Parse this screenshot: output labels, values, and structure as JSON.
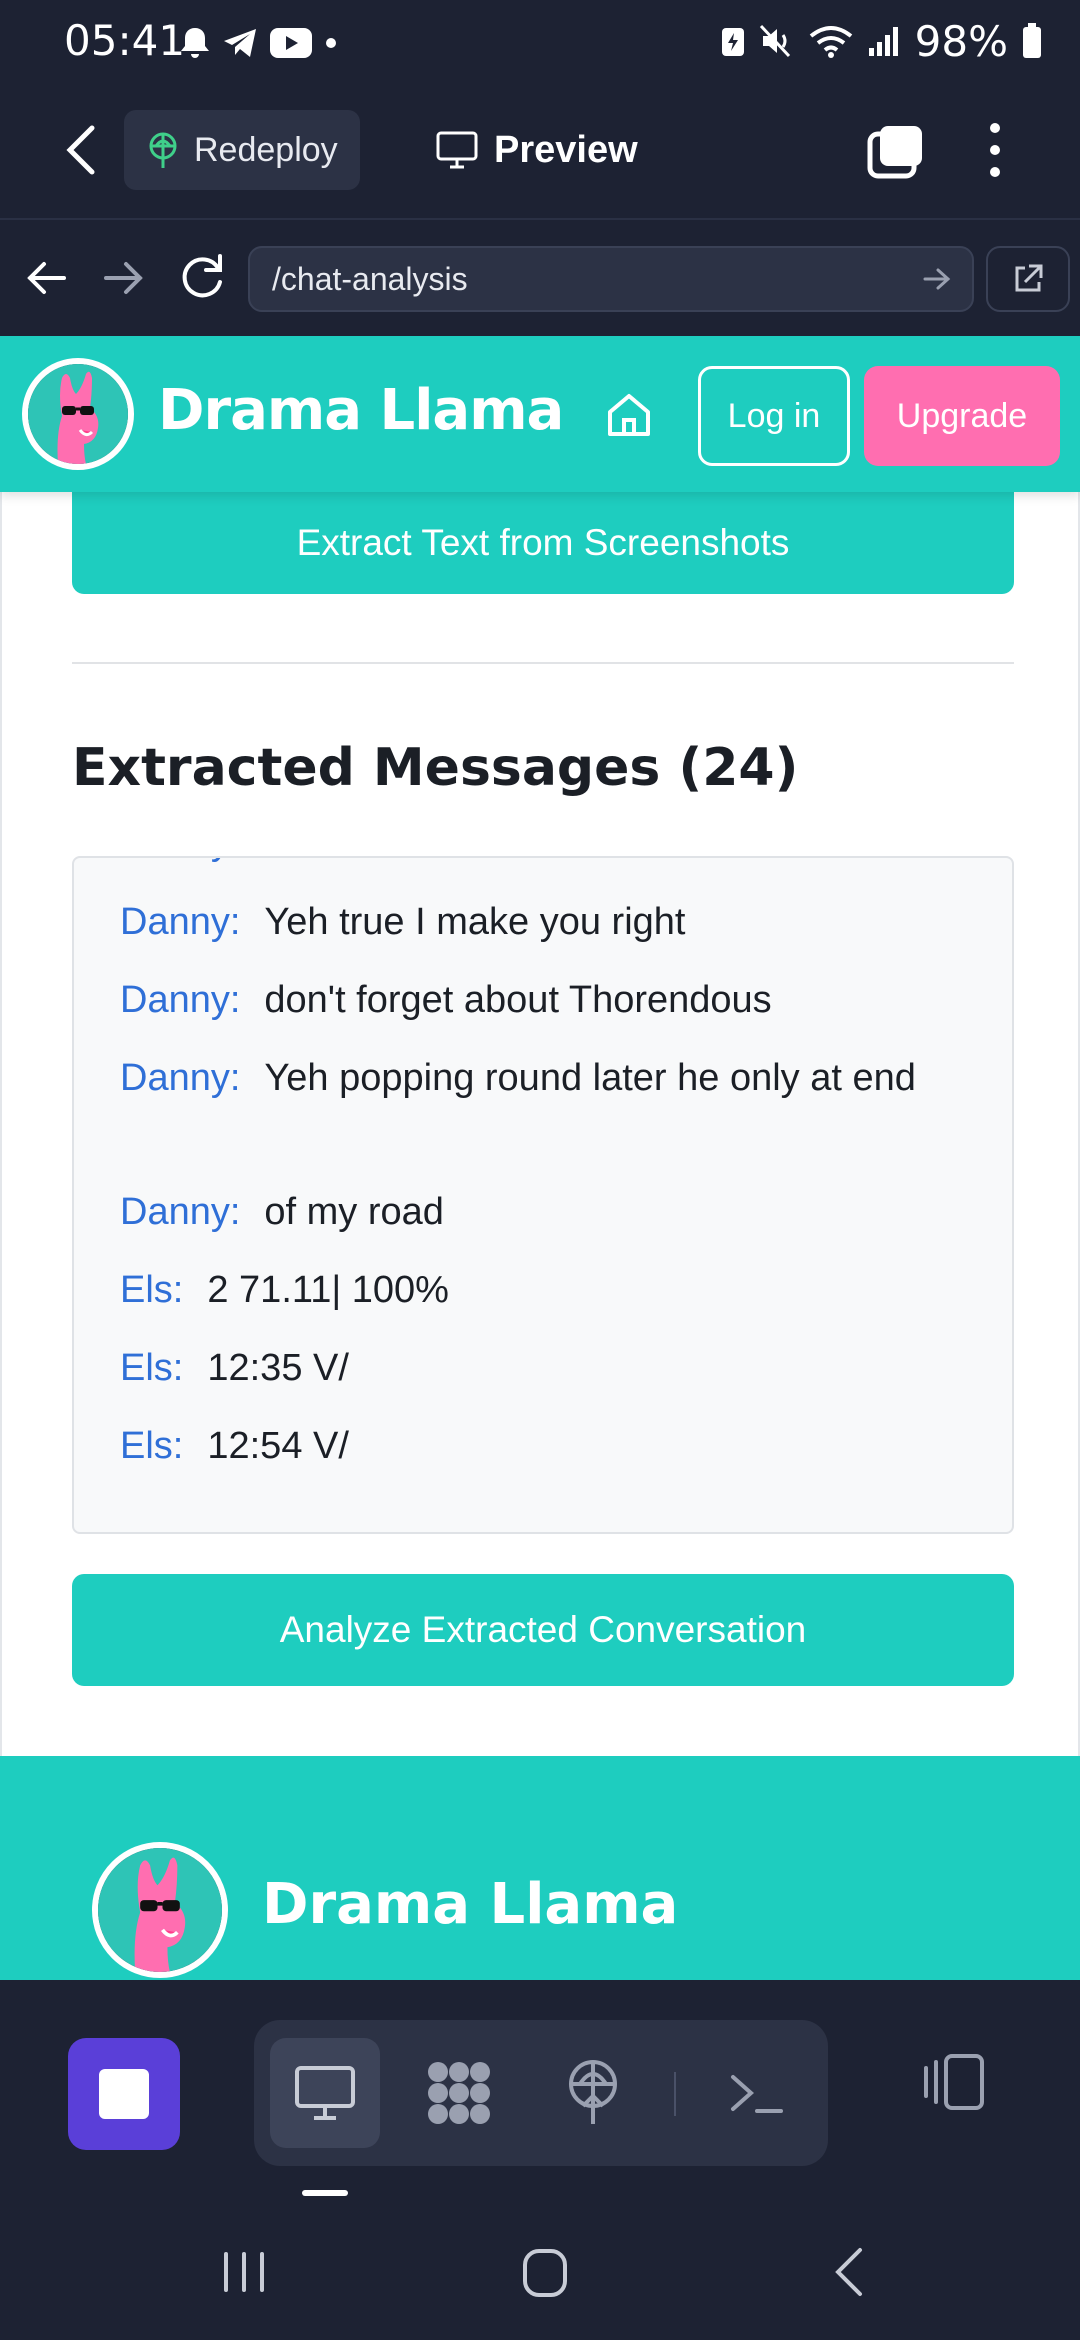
{
  "status_bar": {
    "time": "05:41",
    "battery": "98%"
  },
  "app_toolbar": {
    "redeploy_label": "Redeploy",
    "preview_label": "Preview"
  },
  "browser": {
    "url": "/chat-analysis"
  },
  "site": {
    "brand": "Drama Llama",
    "login_label": "Log in",
    "upgrade_label": "Upgrade",
    "extract_button": "Extract Text from Screenshots",
    "section_title": "Extracted Messages (24)",
    "messages": [
      {
        "sender": "Danny:",
        "text": "Yeh true I make you right"
      },
      {
        "sender": "Danny:",
        "text": "don't forget about Thorendous"
      },
      {
        "sender": "Danny:",
        "text": "Yeh popping round later he only at end"
      },
      {
        "sender": "Danny:",
        "text": "of my road"
      },
      {
        "sender": "Els:",
        "text": "2 71.11| 100%"
      },
      {
        "sender": "Els:",
        "text": "12:35 V/"
      },
      {
        "sender": "Els:",
        "text": "12:54 V/"
      }
    ],
    "analyze_button": "Analyze Extracted Conversation",
    "footer_brand": "Drama Llama"
  },
  "colors": {
    "teal": "#1ecdbf",
    "pink": "#ff6eb0",
    "dark": "#1d2233",
    "sender_blue": "#2f6fd7",
    "purple": "#5a3fd8"
  }
}
